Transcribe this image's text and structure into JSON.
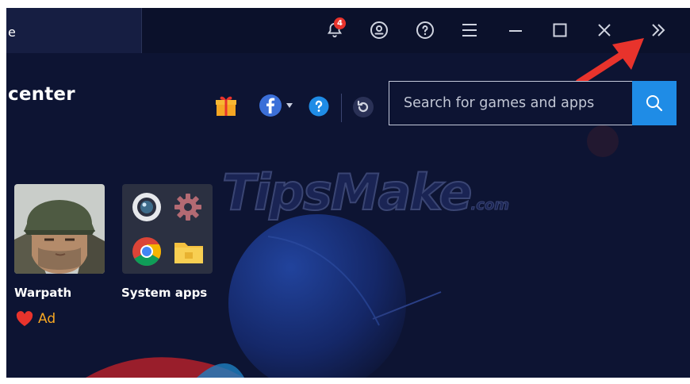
{
  "titlebar": {
    "tab_label": "e",
    "notification_count": "4"
  },
  "header": {
    "heading": "center"
  },
  "search": {
    "placeholder": "Search for games and apps"
  },
  "apps": [
    {
      "label": "Warpath",
      "ad_label": "Ad"
    },
    {
      "label": "System apps"
    }
  ],
  "watermark": {
    "main": "TipsMake",
    "suffix": ".com"
  },
  "colors": {
    "background": "#0d1433",
    "titlebar": "#0b112b",
    "accent": "#1f8ce6",
    "badge": "#e8332c",
    "ad": "#f5a623",
    "annotation_arrow": "#e8332c"
  }
}
